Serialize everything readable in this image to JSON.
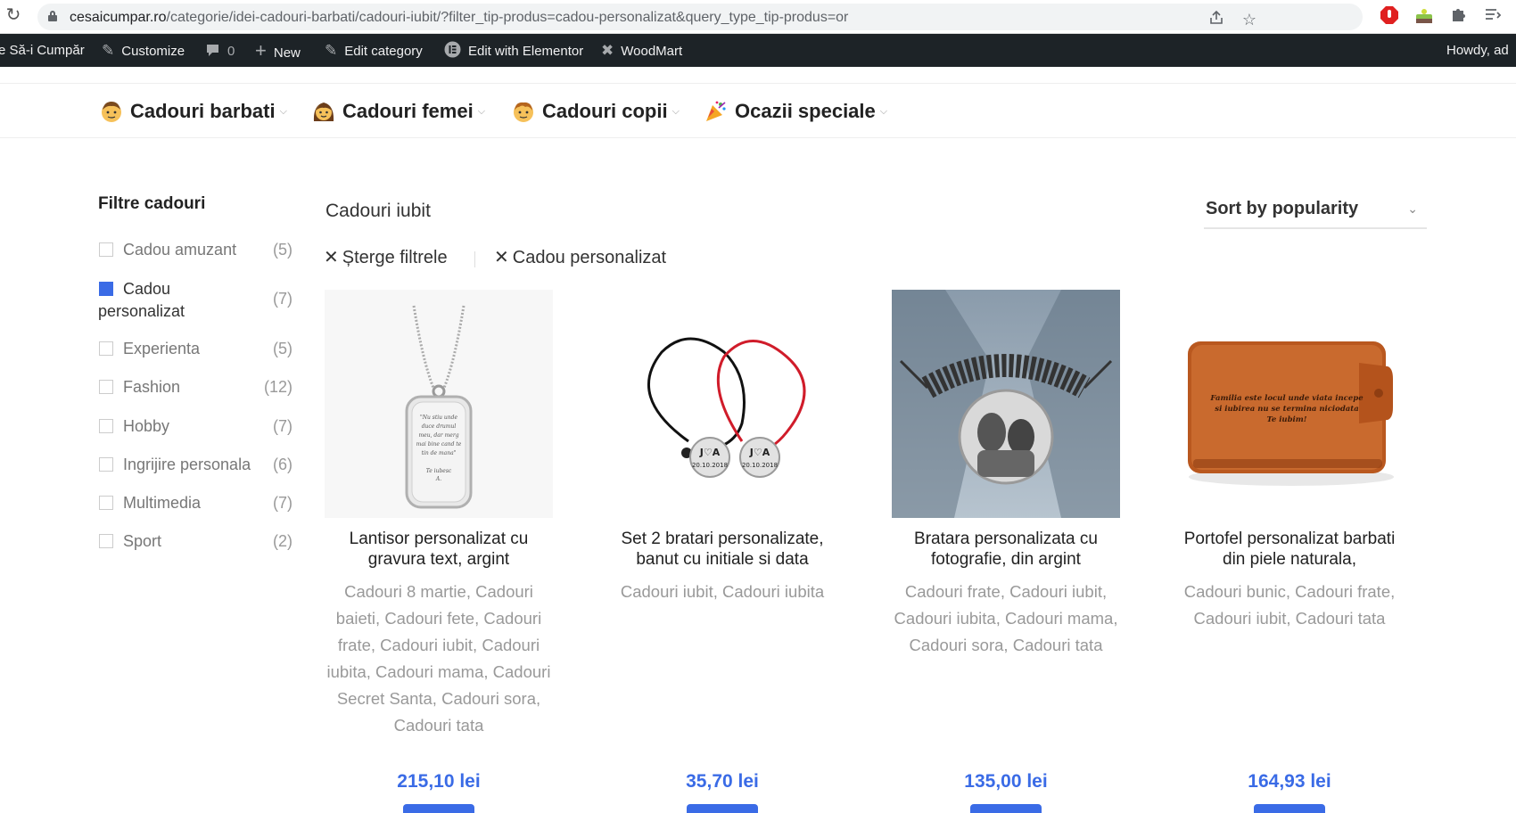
{
  "browser": {
    "url_host": "cesaicumpar.ro",
    "url_path": "/categorie/idei-cadouri-barbati/cadouri-iubit/?filter_tip-produs=cadou-personalizat&query_type_tip-produs=or"
  },
  "admin_bar": {
    "site_name": "e Să-i Cumpăr",
    "customize": "Customize",
    "comments_count": "0",
    "new": "New",
    "edit_category": "Edit category",
    "edit_elementor": "Edit with Elementor",
    "woodmart": "WoodMart",
    "howdy": "Howdy, ad"
  },
  "nav": {
    "items": [
      {
        "label": "Cadouri barbati"
      },
      {
        "label": "Cadouri femei"
      },
      {
        "label": "Cadouri copii"
      },
      {
        "label": "Ocazii speciale"
      }
    ]
  },
  "sidebar": {
    "title": "Filtre cadouri",
    "filters": [
      {
        "label": "Cadou amuzant",
        "count": "(5)",
        "checked": false
      },
      {
        "label": "Cadou personalizat",
        "count": "(7)",
        "checked": true
      },
      {
        "label": "Experienta",
        "count": "(5)",
        "checked": false
      },
      {
        "label": "Fashion",
        "count": "(12)",
        "checked": false
      },
      {
        "label": "Hobby",
        "count": "(7)",
        "checked": false
      },
      {
        "label": "Ingrijire personala",
        "count": "(6)",
        "checked": false
      },
      {
        "label": "Multimedia",
        "count": "(7)",
        "checked": false
      },
      {
        "label": "Sport",
        "count": "(2)",
        "checked": false
      }
    ]
  },
  "main": {
    "title": "Cadouri iubit",
    "sort_label": "Sort by popularity",
    "clear_filters": "Șterge filtrele",
    "active_filter": "Cadou personalizat",
    "accent_color": "#3a6be6"
  },
  "products": [
    {
      "name": "Lantisor personalizat cu gravura text, argint",
      "cats": [
        "Cadouri 8 martie",
        "Cadouri baieti",
        "Cadouri fete",
        "Cadouri frate",
        "Cadouri iubit",
        "Cadouri iubita",
        "Cadouri mama",
        "Cadouri Secret Santa",
        "Cadouri sora",
        "Cadouri tata"
      ],
      "price": "215,10 lei",
      "engraving": [
        "\"Nu stiu unde",
        "duce drumul",
        "meu, dar merg",
        "mai bine cand te",
        "tin de mana\"",
        "",
        "Te iubesc",
        "A."
      ]
    },
    {
      "name": "Set 2 bratari personalizate, banut cu initiale si data",
      "cats": [
        "Cadouri iubit",
        "Cadouri iubita"
      ],
      "price": "35,70 lei",
      "coin_initials": "J♡A",
      "coin_date": "20.10.2018"
    },
    {
      "name": "Bratara personalizata cu fotografie, din argint",
      "cats": [
        "Cadouri frate",
        "Cadouri iubit",
        "Cadouri iubita",
        "Cadouri mama",
        "Cadouri sora",
        "Cadouri tata"
      ],
      "price": "135,00 lei"
    },
    {
      "name": "Portofel personalizat barbati din piele naturala,",
      "cats": [
        "Cadouri bunic",
        "Cadouri frate",
        "Cadouri iubit",
        "Cadouri tata"
      ],
      "price": "164,93 lei",
      "engraving": [
        "Familia este locul unde viata incepe",
        "si iubirea nu se termina niciodata",
        "Te iubim!"
      ]
    }
  ]
}
